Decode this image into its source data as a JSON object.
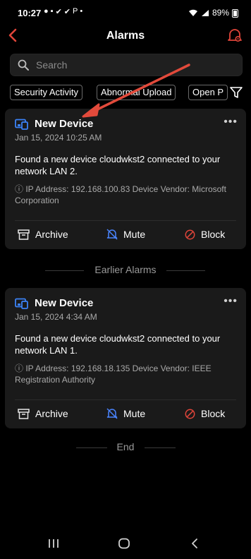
{
  "status_bar": {
    "time": "10:27",
    "battery": "89%",
    "notification_icons": [
      "chat-icon",
      "teams-icon",
      "check-icon",
      "check-icon",
      "pinterest-icon",
      "dot-icon"
    ]
  },
  "header": {
    "title": "Alarms"
  },
  "search": {
    "placeholder": "Search"
  },
  "filters": {
    "chips": [
      "Security Activity",
      "Abnormal Upload",
      "Open P"
    ]
  },
  "cards": [
    {
      "title": "New Device",
      "date": "Jan 15, 2024 10:25 AM",
      "message": "Found a new device cloudwkst2 connected to your network LAN 2.",
      "details": "IP Address: 192.168.100.83 Device Vendor: Microsoft Corporation",
      "actions": {
        "archive": "Archive",
        "mute": "Mute",
        "block": "Block"
      }
    },
    {
      "title": "New Device",
      "date": "Jan 15, 2024 4:34 AM",
      "message": "Found a new device cloudwkst2 connected to your network LAN 1.",
      "details": "IP Address: 192.168.18.135 Device Vendor: IEEE Registration Authority",
      "actions": {
        "archive": "Archive",
        "mute": "Mute",
        "block": "Block"
      }
    }
  ],
  "sections": {
    "earlier": "Earlier Alarms",
    "end": "End"
  },
  "colors": {
    "accent": "#e0453a",
    "device_icon": "#3b82f6",
    "mute_icon": "#4a84ff",
    "card_bg": "#1a1a1a"
  }
}
